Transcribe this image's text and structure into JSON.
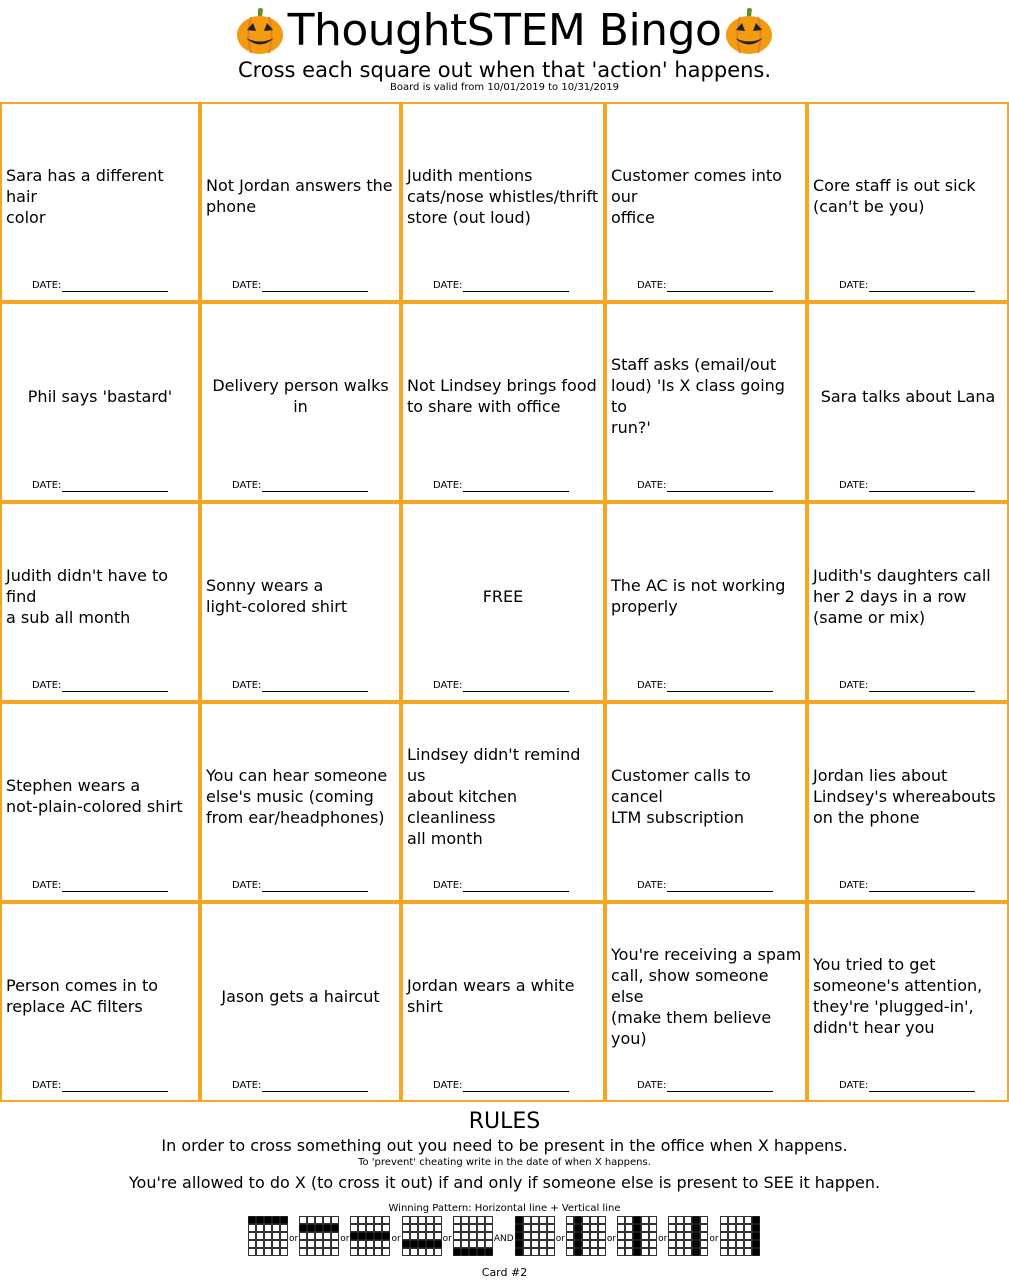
{
  "header": {
    "title": "ThoughtSTEM Bingo",
    "subtitle": "Cross each square out when that 'action' happens.",
    "validity": "Board is valid from 10/01/2019 to 10/31/2019",
    "decoration_icon": "jack-o-lantern-icon"
  },
  "colors": {
    "cell_border": "#f5a623",
    "pumpkin": "#f39c12"
  },
  "date_label": "DATE:",
  "cells": [
    "Sara has a different hair\n color",
    "Not Jordan answers the\n phone",
    "Judith mentions\ncats/nose whistles/thrift\n store (out loud)",
    "Customer comes into our\n office",
    "Core staff is out sick\n (can't be you)",
    "Phil says 'bastard'",
    "Delivery person walks in",
    "Not Lindsey brings food\n to share with office",
    "Staff asks (email/out\nloud) 'Is X class going to\n run?'",
    "Sara talks about Lana",
    "Judith didn't have to find\n a sub all month",
    "Sonny wears a\n light-colored shirt",
    "FREE",
    "The AC is not working\n properly",
    "Judith's daughters call\nher 2 days in a row\n (same or mix)",
    "Stephen wears a\n not-plain-colored shirt",
    "You can hear someone\nelse's music (coming\n from ear/headphones)",
    "Lindsey didn't remind us\nabout kitchen cleanliness\n all month",
    "Customer calls to cancel\n LTM subscription",
    "Jordan lies about\nLindsey's whereabouts\n on the phone",
    "Person comes in to\n replace AC filters",
    "Jason gets a haircut",
    "Jordan wears a white\n shirt",
    "You're receiving a spam\ncall, show someone else\n(make them believe you)",
    "You tried to get\nsomeone's attention,\nthey're 'plugged-in',\n didn't hear you"
  ],
  "rules": {
    "title": "RULES",
    "line1": "In order to cross something out you need to be present in the office when X happens.",
    "line2": "To 'prevent' cheating write in the date of when X happens.",
    "line3": "You're allowed to do X (to cross it out) if and only if someone else is present to SEE it happen.",
    "winning_label": "Winning Pattern: Horizontal line + Vertical line",
    "separators": [
      "or",
      "or",
      "or",
      "or",
      "AND",
      "or",
      "or",
      "or",
      "or"
    ],
    "horizontal_rows": [
      0,
      1,
      2,
      3,
      4
    ],
    "vertical_cols": [
      0,
      1,
      2,
      3,
      4
    ]
  },
  "card": "Card #2"
}
